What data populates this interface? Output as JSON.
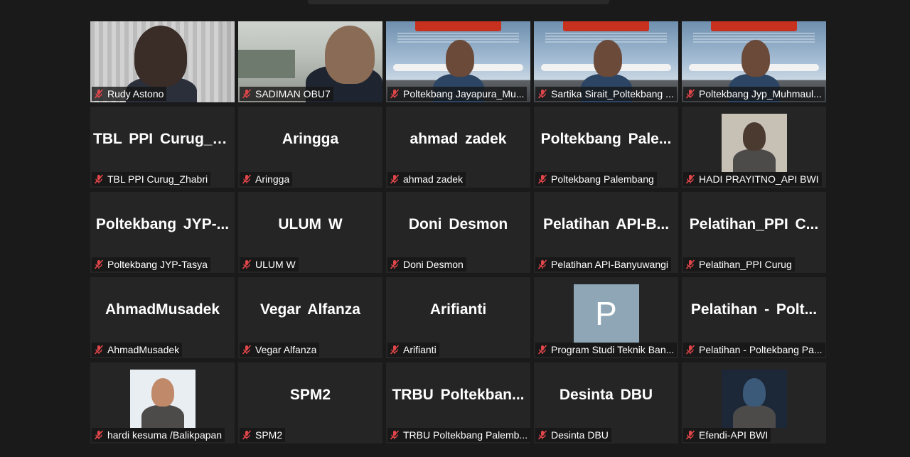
{
  "participants": [
    {
      "big": "",
      "name": "Rudy Astono",
      "video": "office"
    },
    {
      "big": "",
      "name": "SADIMAN OBU7",
      "video": "office2"
    },
    {
      "big": "",
      "name": "Poltekbang Jayapura_Mu...",
      "video": "plane"
    },
    {
      "big": "",
      "name": "Sartika Sirait_Poltekbang ...",
      "video": "plane"
    },
    {
      "big": "",
      "name": "Poltekbang Jyp_Muhmaul...",
      "video": "plane"
    },
    {
      "big": "TBL  PPI  Curug_Z...",
      "name": "TBL PPI Curug_Zhabri"
    },
    {
      "big": "Aringga",
      "name": "Aringga"
    },
    {
      "big": "ahmad zadek",
      "name": "ahmad zadek"
    },
    {
      "big": "Poltekbang  Pale...",
      "name": "Poltekbang Palembang"
    },
    {
      "big": "",
      "name": "HADI PRAYITNO_API BWI",
      "thumb": "photo"
    },
    {
      "big": "Poltekbang  JYP-...",
      "name": "Poltekbang JYP-Tasya"
    },
    {
      "big": "ULUM W",
      "name": "ULUM W"
    },
    {
      "big": "Doni Desmon",
      "name": "Doni Desmon"
    },
    {
      "big": "Pelatihan  API-B...",
      "name": "Pelatihan API-Banyuwangi"
    },
    {
      "big": "Pelatihan_PPI  C...",
      "name": "Pelatihan_PPI Curug"
    },
    {
      "big": "AhmadMusadek",
      "name": "AhmadMusadek"
    },
    {
      "big": "Vegar Alfanza",
      "name": "Vegar Alfanza"
    },
    {
      "big": "Arifianti",
      "name": "Arifianti"
    },
    {
      "big": "",
      "name": "Program Studi Teknik Ban...",
      "avatar": "P"
    },
    {
      "big": "Pelatihan  -  Polt...",
      "name": "Pelatihan - Poltekbang Pa..."
    },
    {
      "big": "",
      "name": "hardi kesuma /Balikpapan",
      "thumb": "photo2"
    },
    {
      "big": "SPM2",
      "name": "SPM2"
    },
    {
      "big": "TRBU  Poltekban...",
      "name": "TRBU Poltekbang Palemb..."
    },
    {
      "big": "Desinta DBU",
      "name": "Desinta DBU"
    },
    {
      "big": "",
      "name": "Efendi-API BWI",
      "thumb": "photo3"
    }
  ],
  "colors": {
    "background": "#1a1a1a",
    "tile": "#252525",
    "muted_mic": "#e0464a"
  },
  "icons": {
    "muted": "mic-muted-icon"
  }
}
